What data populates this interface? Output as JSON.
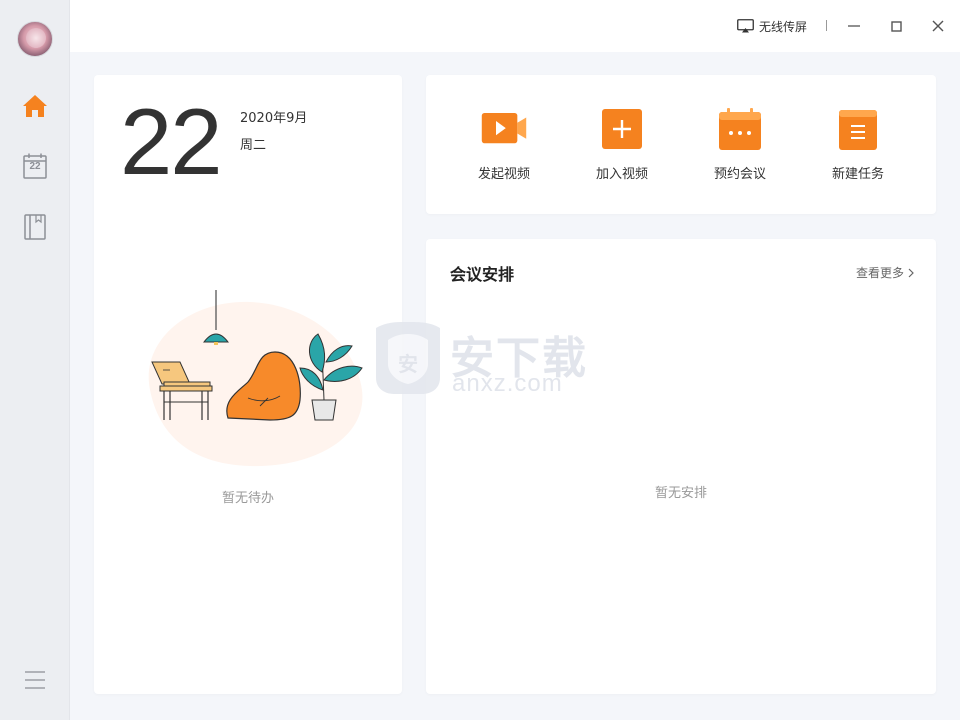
{
  "topbar": {
    "cast_label": "无线传屏"
  },
  "sidebar": {
    "items": [
      {
        "name": "home",
        "icon": "home-icon"
      },
      {
        "name": "calendar",
        "icon": "calendar-icon",
        "badge": "22"
      },
      {
        "name": "notes",
        "icon": "notebook-icon"
      },
      {
        "name": "menu",
        "icon": "menu-icon"
      }
    ]
  },
  "date_card": {
    "day": "22",
    "year_month": "2020年9月",
    "weekday": "周二",
    "empty_text": "暂无待办"
  },
  "actions": [
    {
      "label": "发起视频",
      "icon": "video-camera-icon"
    },
    {
      "label": "加入视频",
      "icon": "plus-icon"
    },
    {
      "label": "预约会议",
      "icon": "calendar-dots-icon"
    },
    {
      "label": "新建任务",
      "icon": "task-list-icon"
    }
  ],
  "meeting": {
    "title": "会议安排",
    "more_label": "查看更多",
    "empty_text": "暂无安排"
  },
  "watermark": {
    "text": "安下载",
    "sub": "anxz.com",
    "badge": "安"
  },
  "colors": {
    "accent": "#f5821f",
    "accent_light": "#ffa74d",
    "sidebar_bg": "#eceef2",
    "page_bg": "#f4f6fa"
  }
}
